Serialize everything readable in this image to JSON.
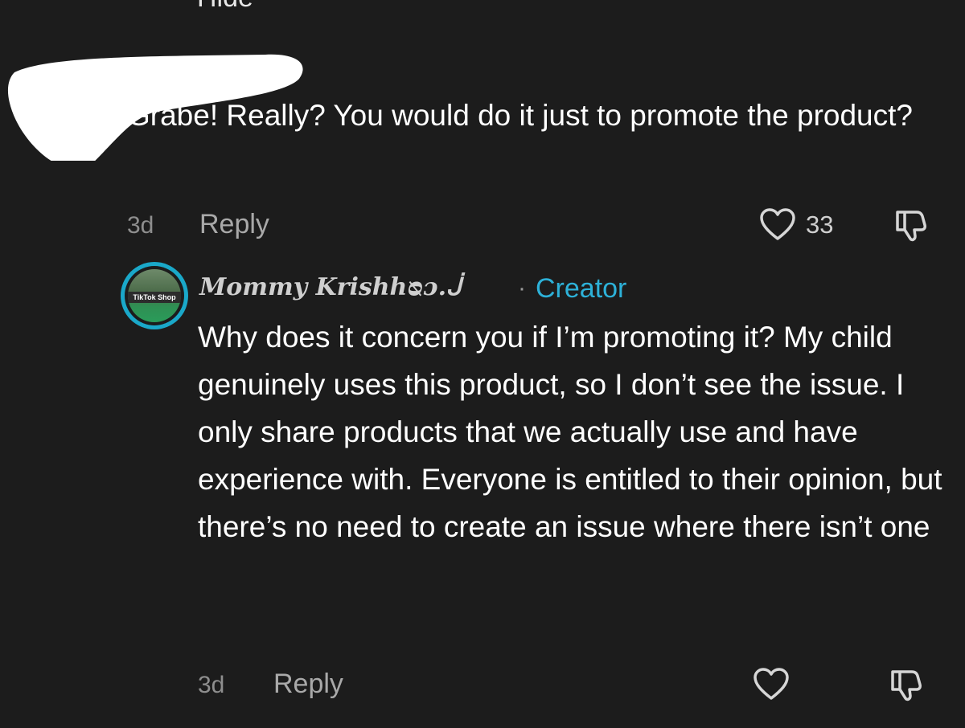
{
  "top_partial_text": "Hide",
  "comment1": {
    "text": "Grabe! Really? You would do it just to promote the product?",
    "time": "3d",
    "reply_label": "Reply",
    "like_count": "33",
    "icons": [
      "heart-icon",
      "dislike-icon"
    ]
  },
  "comment2": {
    "username": "Mommy Krishhᴓɔ.ᒎ",
    "separator": "·",
    "badge": "Creator",
    "avatar_label": "TikTok Shop",
    "text": "Why does it concern you if I’m promoting it? My child genuinely uses this product, so I don’t see the issue. I only share products that we actually use and have experience with. Everyone is entitled to their opinion, but there’s no need to create an issue where there isn’t one",
    "time": "3d",
    "reply_label": "Reply",
    "icons": [
      "heart-icon",
      "dislike-icon"
    ]
  },
  "colors": {
    "background": "#1c1c1c",
    "text": "#ffffff",
    "muted": "#8e8e8e",
    "creator_accent": "#2db1d8"
  }
}
